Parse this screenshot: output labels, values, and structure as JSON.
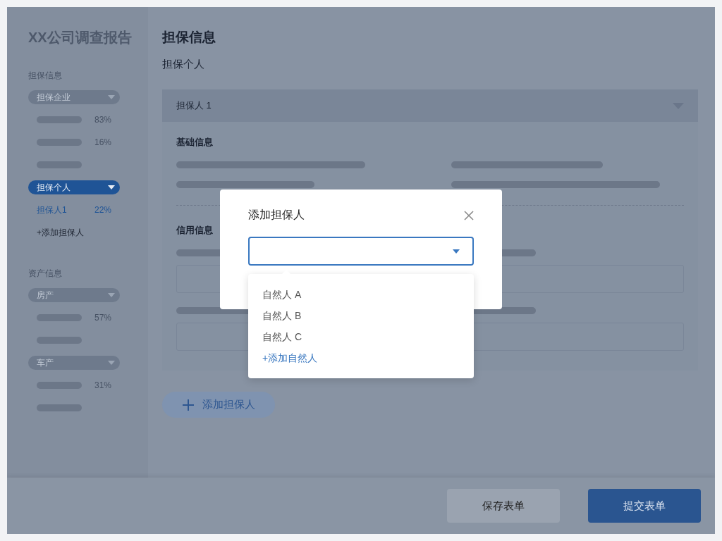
{
  "sidebar": {
    "title": "XX公司调查报告",
    "sections": [
      {
        "heading": "担保信息",
        "groups": [
          {
            "label": "担保企业",
            "selected": false,
            "items": [
              {
                "kind": "placeholder",
                "percent": "83%"
              },
              {
                "kind": "placeholder",
                "percent": "16%"
              },
              {
                "kind": "placeholder"
              }
            ]
          },
          {
            "label": "担保个人",
            "selected": true,
            "items": [
              {
                "kind": "entry",
                "label": "担保人1",
                "percent": "22%",
                "selected": true
              },
              {
                "kind": "add",
                "label": "+添加担保人"
              }
            ]
          }
        ]
      },
      {
        "heading": "资产信息",
        "groups": [
          {
            "label": "房产",
            "selected": false,
            "items": [
              {
                "kind": "placeholder",
                "percent": "57%"
              },
              {
                "kind": "placeholder"
              }
            ]
          },
          {
            "label": "车产",
            "selected": false,
            "items": [
              {
                "kind": "placeholder",
                "percent": "31%"
              },
              {
                "kind": "placeholder"
              }
            ]
          }
        ]
      }
    ]
  },
  "main": {
    "title": "担保信息",
    "subtitle": "担保个人",
    "panel": {
      "title": "担保人 1",
      "expanded": true,
      "sections": [
        {
          "kind": "pairs",
          "heading": "基础信息"
        },
        {
          "kind": "fields",
          "heading": "信用信息"
        }
      ]
    },
    "add_button": "添加担保人"
  },
  "footer": {
    "buttons": [
      {
        "label": "保存表单",
        "kind": "secondary"
      },
      {
        "label": "提交表单",
        "kind": "primary"
      }
    ]
  },
  "modal": {
    "title": "添加担保人",
    "select": {
      "open": true
    },
    "options": [
      {
        "kind": "option",
        "label": "自然人 A"
      },
      {
        "kind": "option",
        "label": "自然人 B"
      },
      {
        "kind": "option",
        "label": "自然人 C"
      },
      {
        "kind": "add",
        "label": "+添加自然人"
      }
    ]
  }
}
